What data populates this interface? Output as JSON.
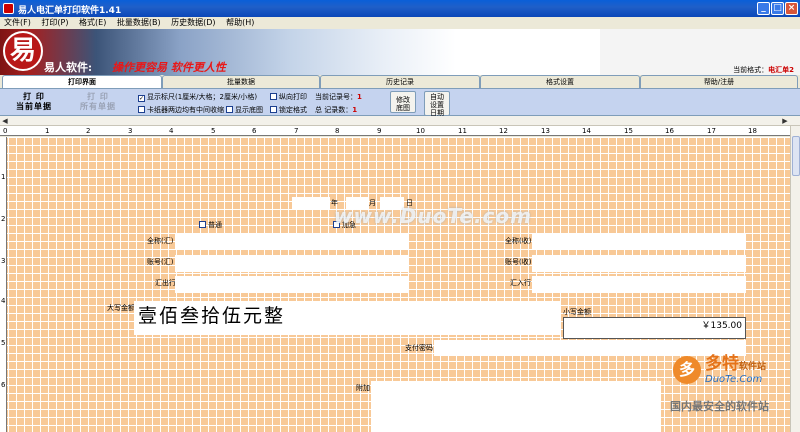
{
  "window": {
    "title": "易人电汇单打印软件1.41",
    "min_label": "_",
    "max_label": "□",
    "close_label": "×"
  },
  "menu": [
    "文件(F)",
    "打印(P)",
    "格式(E)",
    "批量数据(B)",
    "历史数据(D)",
    "帮助(H)"
  ],
  "banner": {
    "logo_char": "易",
    "title": "易人软件:",
    "slogan": "操作更容易  软件更人性",
    "current_format_label": "当前格式：",
    "current_format_value": "电汇单2"
  },
  "tabs": [
    "打印界面",
    "批量数据",
    "历史记录",
    "格式设置",
    "帮助/注册"
  ],
  "toolbar": {
    "print_current_l1": "打    印",
    "print_current_l2": "当前单据",
    "print_all_l1": "打    印",
    "print_all_l2": "所有单据",
    "show_ruler": "显示标尺(1厘米/大格；2厘米/小格)",
    "show_ruler_checked": "✓",
    "landscape_print": "纵向打印",
    "center_paper": "卡纸器两边均有中间收缩",
    "show_background": "显示底图",
    "lock_format": "锁定格式",
    "current_record_label": "当前记录号：",
    "current_record_value": "1",
    "total_records_label": "总   记录数：",
    "total_records_value": "1",
    "modify_bg": [
      "修改",
      "底图"
    ],
    "auto_date": [
      "自动",
      "设置",
      "日期"
    ]
  },
  "ruler_numbers": [
    "0",
    "1",
    "2",
    "3",
    "4",
    "5",
    "6",
    "7",
    "8",
    "9",
    "10",
    "11",
    "12",
    "13",
    "14",
    "15",
    "16",
    "17",
    "18"
  ],
  "vruler_numbers": [
    "1",
    "2",
    "3",
    "4",
    "5",
    "6"
  ],
  "form": {
    "year": "年",
    "month": "月",
    "day": "日",
    "normal": "普通",
    "urgent": "加急",
    "payer_name": "全称(汇)",
    "payer_account": "账号(汇)",
    "payer_bank": "汇出行",
    "payee_name": "全称(收)",
    "payee_account": "账号(收)",
    "payee_bank": "汇入行",
    "amount_upper_label": "大写金额",
    "amount_upper_value": "壹佰叁拾伍元整",
    "amount_lower_label": "小写金额",
    "amount_lower_value": "￥135.00",
    "password_label": "支付密码",
    "note_label": "附加"
  },
  "watermark": {
    "duote": "www.DuoTe.com",
    "brand_main": "多特",
    "brand_suffix": "软件站",
    "brand_url": "DuoTe.Com",
    "brand_slogan": "国内最安全的软件站",
    "brand_icon": "多"
  }
}
